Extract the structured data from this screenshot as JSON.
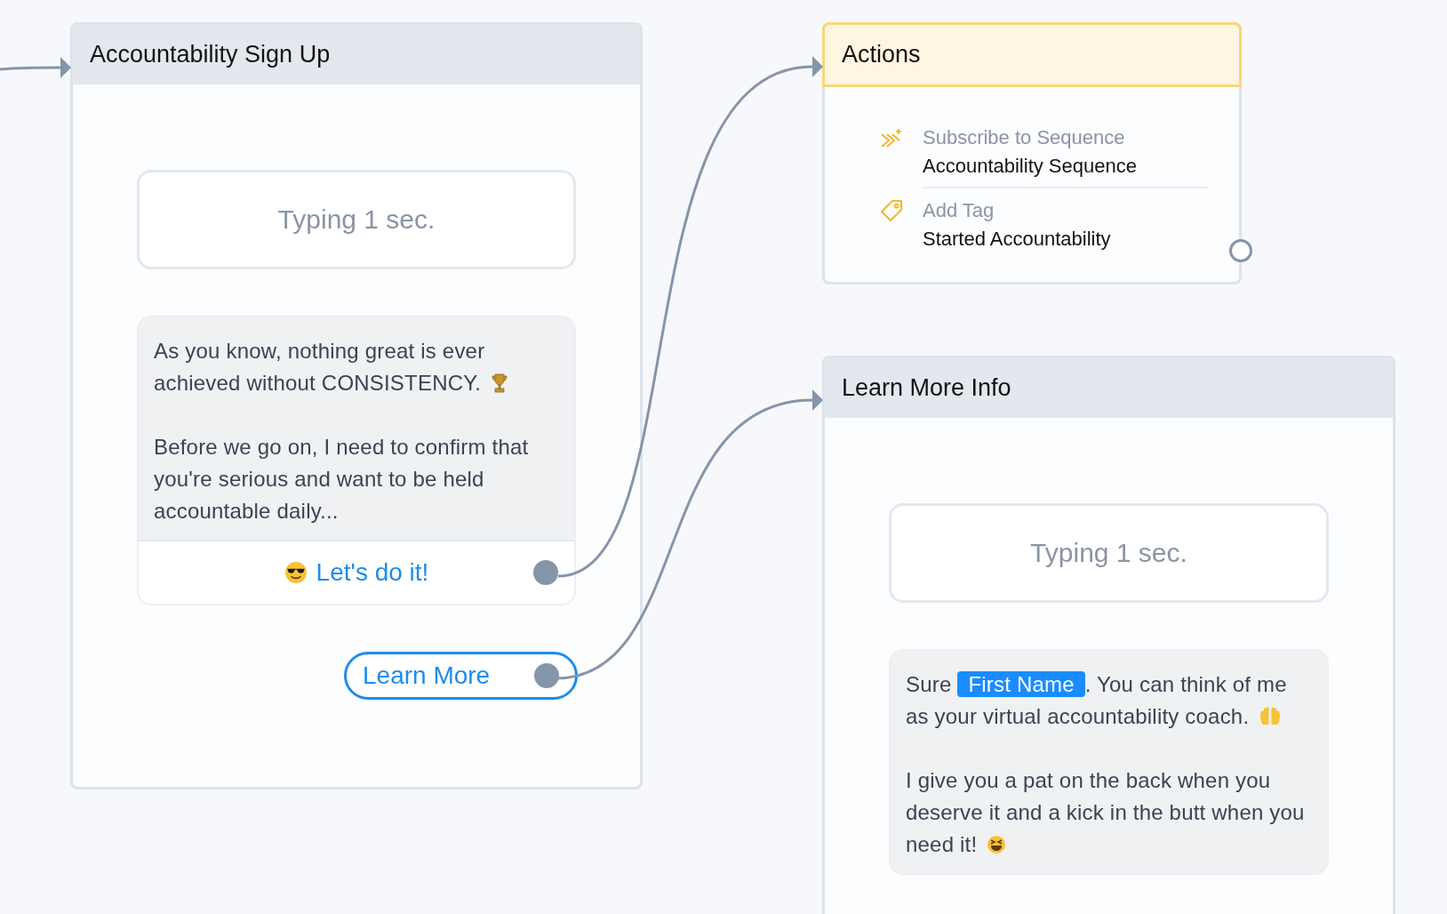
{
  "canvas": {
    "nodes": [
      {
        "kind": "flow",
        "title": "Accountability Sign Up",
        "blocks": [
          {
            "kind": "typing",
            "text": "Typing 1 sec."
          },
          {
            "kind": "message",
            "paragraphs": [
              {
                "parts": [
                  {
                    "kind": "text",
                    "text": "As you know, nothing great is ever achieved without CONSISTENCY."
                  }
                ]
              },
              {
                "parts": [
                  {
                    "kind": "text",
                    "text": "Before we go on, I need to confirm that you're serious and want to be held accountable daily..."
                  }
                ]
              }
            ],
            "quick_replies": [
              {
                "label": "Let's do it!",
                "connected": true
              }
            ]
          },
          {
            "kind": "button",
            "label": "Learn More",
            "connected": true
          }
        ]
      },
      {
        "kind": "actions",
        "title": "Actions",
        "connected": false,
        "items": [
          {
            "kind": "sequence",
            "label": "Subscribe to Sequence",
            "value": "Accountability Sequence"
          },
          {
            "kind": "tag",
            "label": "Add Tag",
            "value": "Started Accountability"
          }
        ]
      },
      {
        "kind": "flow",
        "title": "Learn More Info",
        "blocks": [
          {
            "kind": "typing",
            "text": "Typing 1 sec."
          },
          {
            "kind": "message",
            "paragraphs": [
              {
                "parts": [
                  {
                    "kind": "text",
                    "text": "Sure "
                  },
                  {
                    "kind": "variable",
                    "text": "First Name"
                  },
                  {
                    "kind": "text",
                    "text": ". You can think of me as your virtual accountability coach."
                  }
                ]
              },
              {
                "parts": [
                  {
                    "kind": "text",
                    "text": "I give you a pat on the back when you deserve it and a kick in the butt when you need it!"
                  }
                ]
              }
            ]
          }
        ]
      }
    ]
  }
}
